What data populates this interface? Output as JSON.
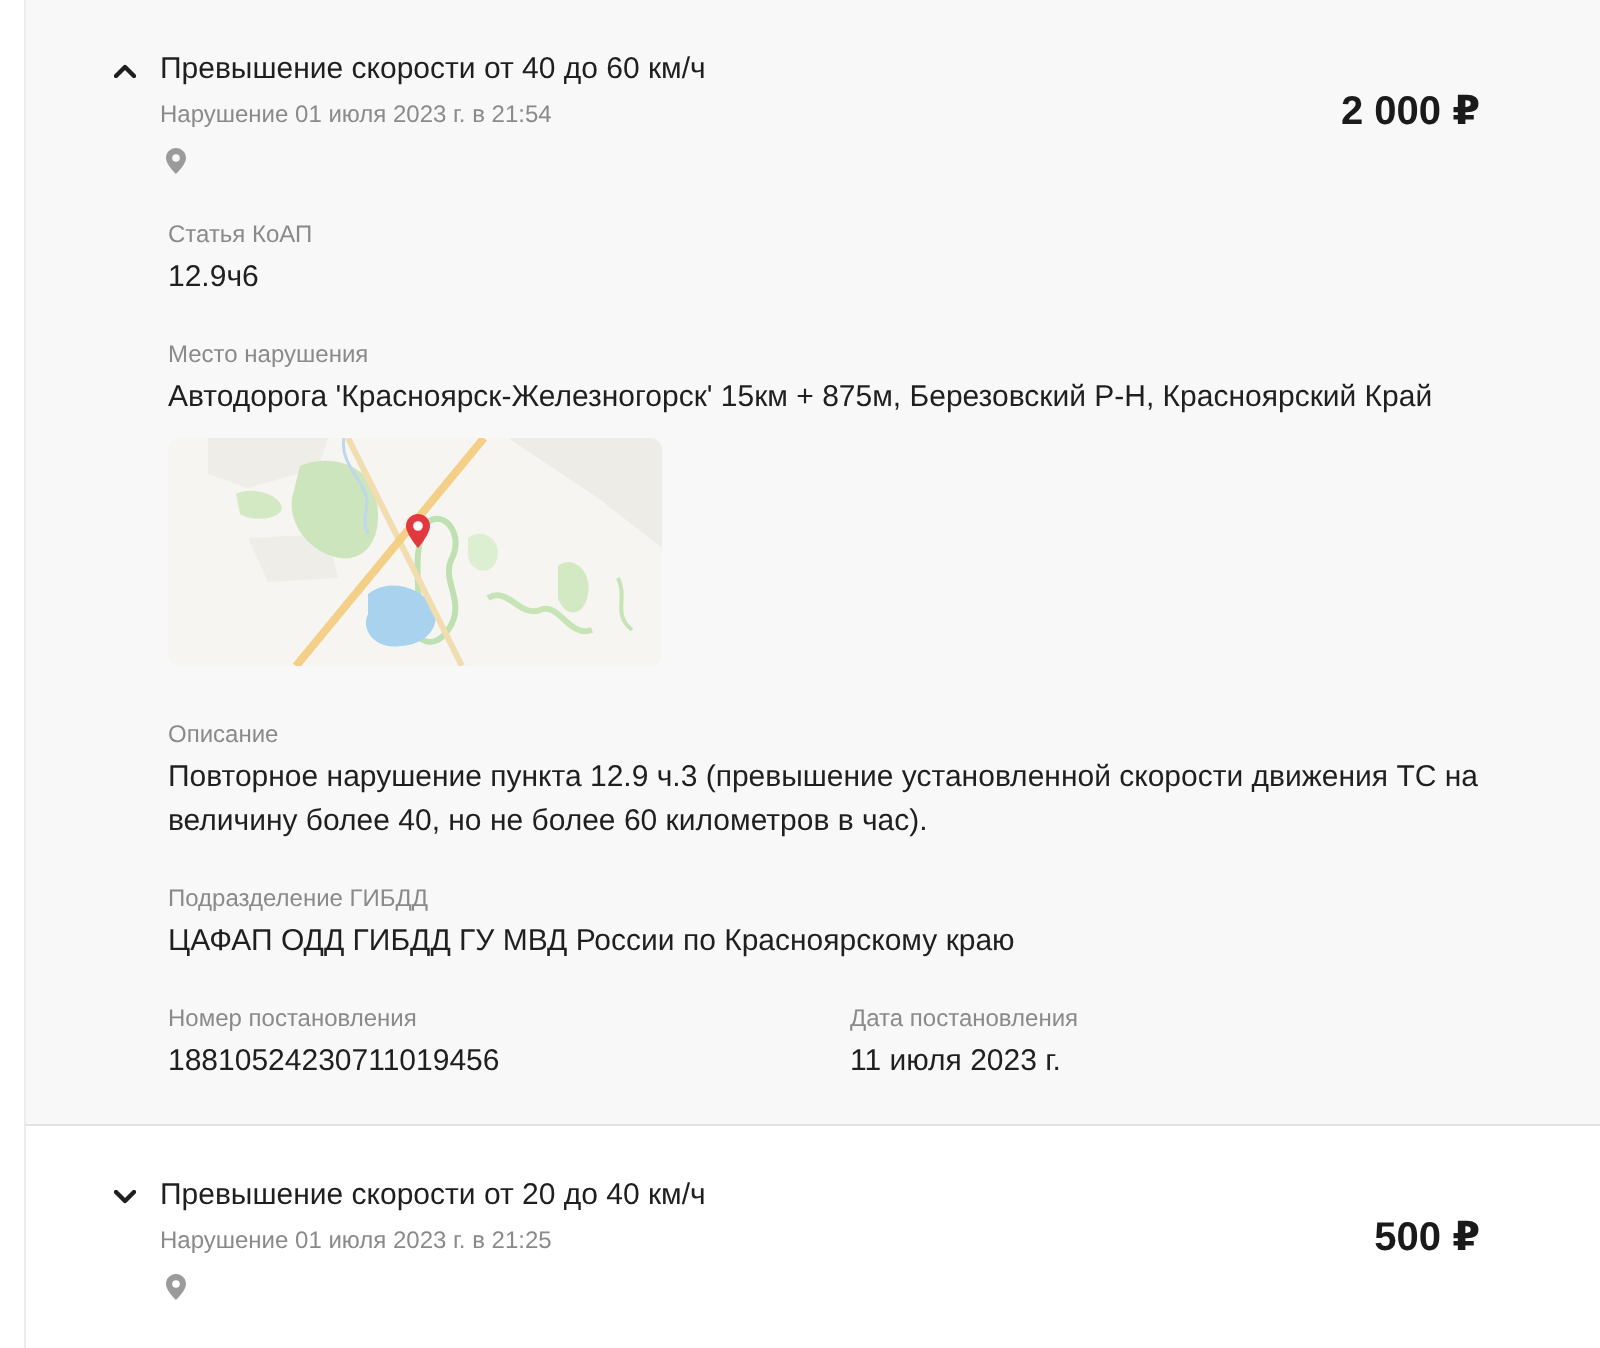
{
  "violations": [
    {
      "title": "Превышение скорости от 40 до 60 км/ч",
      "expanded": true,
      "date": "Нарушение 01 июля 2023 г. в 21:54",
      "amount": "2 000 ₽",
      "details": {
        "article": {
          "label": "Статья КоАП",
          "value": "12.9ч6"
        },
        "place": {
          "label": "Место нарушения",
          "value": "Автодорога 'Красноярск-Железногорск' 15км + 875м, Березовский Р-Н, Красноярский Край"
        },
        "description": {
          "label": "Описание",
          "value": "Повторное нарушение пункта 12.9 ч.3 (превышение установленной скорости движения ТС на величину более 40, но не более 60 километров в час)."
        },
        "department": {
          "label": "Подразделение ГИБДД",
          "value": "ЦАФАП ОДД ГИБДД ГУ МВД России по Красноярскому краю"
        },
        "resolution_number": {
          "label": "Номер постановления",
          "value": "18810524230711019456"
        },
        "resolution_date": {
          "label": "Дата постановления",
          "value": "11 июля 2023 г."
        }
      }
    },
    {
      "title": "Превышение скорости от 20 до 40 км/ч",
      "expanded": false,
      "date": "Нарушение 01 июля 2023 г. в 21:25",
      "amount": "500 ₽"
    }
  ]
}
